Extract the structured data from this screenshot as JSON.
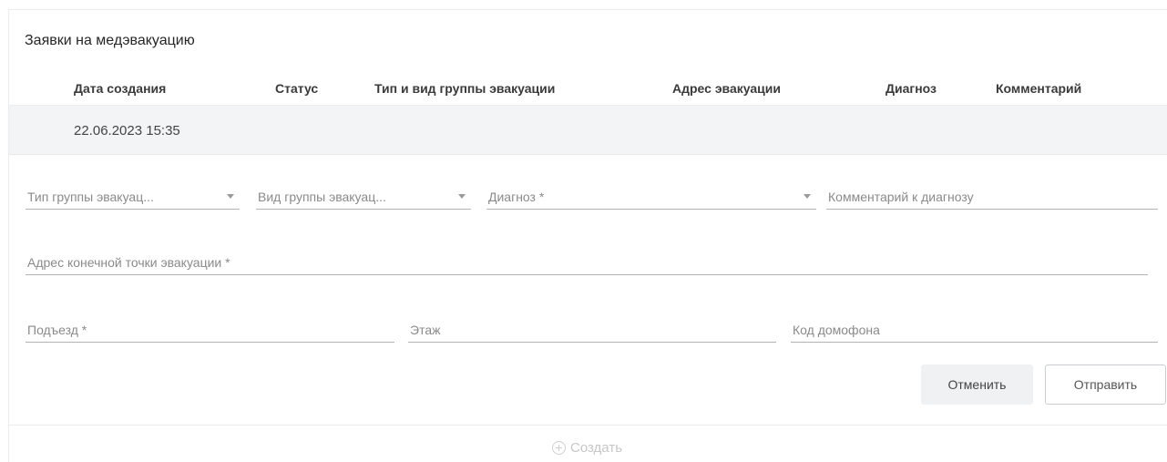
{
  "panel": {
    "title": "Заявки на медэвакуацию"
  },
  "table": {
    "columns": [
      "Дата создания",
      "Статус",
      "Тип и вид группы эвакуации",
      "Адрес эвакуации",
      "Диагноз",
      "Комментарий"
    ],
    "rows": [
      {
        "date": "22.06.2023 15:35"
      }
    ]
  },
  "form": {
    "group_type": {
      "placeholder": "Тип группы эвакуац..."
    },
    "group_kind": {
      "placeholder": "Вид группы эвакуац..."
    },
    "diagnosis": {
      "placeholder": "Диагноз *"
    },
    "diagnosis_comment": {
      "placeholder": "Комментарий к диагнозу"
    },
    "end_address": {
      "placeholder": "Адрес конечной точки эвакуации *"
    },
    "entrance": {
      "placeholder": "Подъезд *"
    },
    "floor": {
      "placeholder": "Этаж"
    },
    "intercom": {
      "placeholder": "Код домофона"
    },
    "cancel_label": "Отменить",
    "send_label": "Отправить"
  },
  "footer": {
    "create_label": "Создать",
    "create_icon": "plus-circle-icon"
  }
}
